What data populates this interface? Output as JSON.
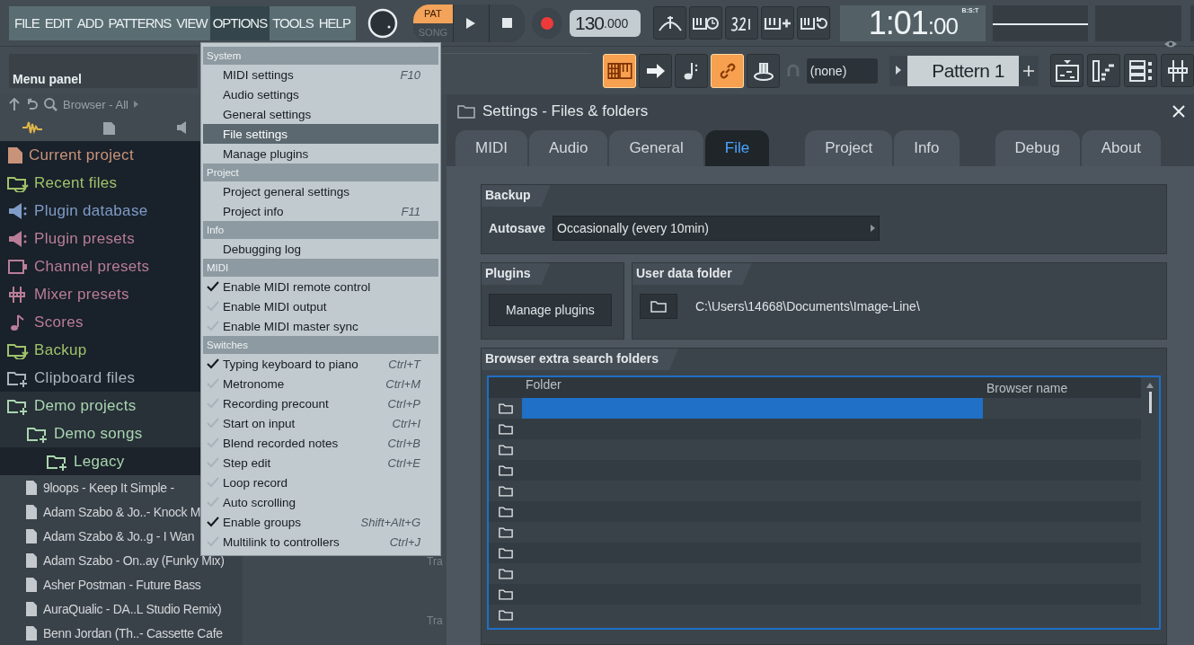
{
  "menu_bar": {
    "items": [
      {
        "label": "FILE",
        "selected": false
      },
      {
        "label": "EDIT",
        "selected": false
      },
      {
        "label": "ADD",
        "selected": false
      },
      {
        "label": "PATTERNS",
        "selected": false
      },
      {
        "label": "VIEW",
        "selected": false
      },
      {
        "label": "OPTIONS",
        "selected": true
      },
      {
        "label": "TOOLS",
        "selected": false
      },
      {
        "label": "HELP",
        "selected": false
      }
    ]
  },
  "transport": {
    "modes": [
      {
        "label": "PAT",
        "selected": true
      },
      {
        "label": "SONG",
        "selected": false
      }
    ],
    "tempo": {
      "whole": "130",
      "fraction": ".000"
    }
  },
  "time_display": {
    "value": "1:01",
    "sub": ":00",
    "format": "B:S:T"
  },
  "hint_bar": {
    "title": "Menu panel"
  },
  "toolbar_toggles": [
    {
      "on": true
    },
    {
      "on": false
    },
    {
      "on": false
    },
    {
      "on": true
    },
    {
      "on": false
    }
  ],
  "midi_device": {
    "value": "(none)"
  },
  "pattern_selector": {
    "value": "Pattern 1"
  },
  "browser": {
    "title": "Browser - All",
    "tree": [
      {
        "label": "Current project",
        "color": "#c9937a"
      },
      {
        "label": "Recent files",
        "color": "#9fc26b"
      },
      {
        "label": "Plugin database",
        "color": "#7f9cc8"
      },
      {
        "label": "Plugin presets",
        "color": "#b97d98"
      },
      {
        "label": "Channel presets",
        "color": "#b97d98"
      },
      {
        "label": "Mixer presets",
        "color": "#b97d98"
      },
      {
        "label": "Scores",
        "color": "#b97d98"
      },
      {
        "label": "Backup",
        "color": "#9fc26b"
      },
      {
        "label": "Clipboard files",
        "color": "#a9b4bd"
      },
      {
        "label": "Demo projects",
        "color": "#a9d6b0",
        "expanded": true,
        "children": [
          {
            "label": "Demo songs",
            "color": "#a9d6b0",
            "expanded": true,
            "children": [
              {
                "label": "Legacy",
                "color": "#a9d6b0",
                "expanded": false
              }
            ]
          }
        ]
      }
    ],
    "files": [
      "9loops - Keep It Simple -",
      "Adam Szabo & Jo..- Knock M",
      "Adam Szabo & Jo..g - I Wan",
      "Adam Szabo - On..ay (Funky Mix)",
      "Asher Postman - Future Bass",
      "AuraQualic - DA..L Studio Remix)",
      "Benn Jordan (Th..- Cassette Cafe"
    ]
  },
  "playlist": {
    "track_labels": [
      "Tra",
      "Tra"
    ]
  },
  "options_menu": {
    "sections": [
      {
        "title": "System",
        "items": [
          {
            "kind": "command",
            "label": "MIDI settings",
            "shortcut": "F10",
            "highlighted": false
          },
          {
            "kind": "command",
            "label": "Audio settings",
            "highlighted": false
          },
          {
            "kind": "command",
            "label": "General settings",
            "highlighted": false
          },
          {
            "kind": "command",
            "label": "File settings",
            "highlighted": true
          },
          {
            "kind": "command",
            "label": "Manage plugins",
            "highlighted": false
          }
        ]
      },
      {
        "title": "Project",
        "items": [
          {
            "kind": "command",
            "label": "Project general settings",
            "highlighted": false
          },
          {
            "kind": "command",
            "label": "Project info",
            "shortcut": "F11",
            "highlighted": false
          }
        ]
      },
      {
        "title": "Info",
        "items": [
          {
            "kind": "command",
            "label": "Debugging log",
            "highlighted": false
          }
        ]
      },
      {
        "title": "MIDI",
        "items": [
          {
            "kind": "toggle",
            "label": "Enable MIDI remote control",
            "checked": true,
            "highlighted": false
          },
          {
            "kind": "toggle",
            "label": "Enable MIDI output",
            "checked": false,
            "highlighted": false
          },
          {
            "kind": "toggle",
            "label": "Enable MIDI master sync",
            "checked": false,
            "highlighted": false
          }
        ]
      },
      {
        "title": "Switches",
        "items": [
          {
            "kind": "toggle",
            "label": "Typing keyboard to piano",
            "shortcut": "Ctrl+T",
            "checked": true,
            "highlighted": false
          },
          {
            "kind": "toggle",
            "label": "Metronome",
            "shortcut": "Ctrl+M",
            "checked": false,
            "highlighted": false
          },
          {
            "kind": "toggle",
            "label": "Recording precount",
            "shortcut": "Ctrl+P",
            "checked": false,
            "highlighted": false
          },
          {
            "kind": "toggle",
            "label": "Start on input",
            "shortcut": "Ctrl+I",
            "checked": false,
            "highlighted": false
          },
          {
            "kind": "toggle",
            "label": "Blend recorded notes",
            "shortcut": "Ctrl+B",
            "checked": false,
            "highlighted": false
          },
          {
            "kind": "toggle",
            "label": "Step edit",
            "shortcut": "Ctrl+E",
            "checked": false,
            "highlighted": false
          },
          {
            "kind": "toggle",
            "label": "Loop record",
            "checked": false,
            "highlighted": false
          },
          {
            "kind": "toggle",
            "label": "Auto scrolling",
            "checked": false,
            "highlighted": false
          },
          {
            "kind": "toggle",
            "label": "Enable groups",
            "shortcut": "Shift+Alt+G",
            "checked": true,
            "highlighted": false
          },
          {
            "kind": "toggle",
            "label": "Multilink to controllers",
            "shortcut": "Ctrl+J",
            "checked": false,
            "highlighted": false
          }
        ]
      }
    ]
  },
  "settings_dialog": {
    "title": "Settings - Files & folders",
    "tab_groups": [
      [
        {
          "label": "MIDI",
          "selected": false
        },
        {
          "label": "Audio",
          "selected": false
        },
        {
          "label": "General",
          "selected": false
        },
        {
          "label": "File",
          "selected": true
        }
      ],
      [
        {
          "label": "Project",
          "selected": false
        },
        {
          "label": "Info",
          "selected": false
        }
      ],
      [
        {
          "label": "Debug",
          "selected": false
        },
        {
          "label": "About",
          "selected": false
        }
      ]
    ],
    "backup": {
      "title": "Backup",
      "autosave_label": "Autosave",
      "autosave_value": "Occasionally (every 10min)"
    },
    "plugins": {
      "title": "Plugins",
      "button": "Manage plugins"
    },
    "user_data": {
      "title": "User data folder",
      "path": "C:\\Users\\14668\\Documents\\Image-Line\\"
    },
    "search_folders": {
      "title": "Browser extra search folders",
      "columns": [
        "Folder",
        "Browser name"
      ],
      "rows": [
        {
          "selected": true
        },
        {
          "selected": false
        },
        {
          "selected": false
        },
        {
          "selected": false
        },
        {
          "selected": false
        },
        {
          "selected": false
        },
        {
          "selected": false
        },
        {
          "selected": false
        },
        {
          "selected": false
        },
        {
          "selected": false
        },
        {
          "selected": false
        }
      ]
    }
  }
}
